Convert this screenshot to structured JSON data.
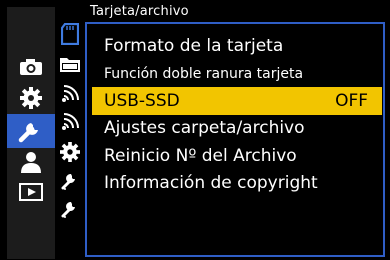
{
  "header": {
    "title": "Tarjeta/archivo"
  },
  "left_icons": [
    {
      "name": "camera-icon"
    },
    {
      "name": "gear-icon"
    },
    {
      "name": "wrench-icon",
      "selected": true
    },
    {
      "name": "person-icon"
    },
    {
      "name": "playback-icon"
    }
  ],
  "middle_icons": [
    {
      "name": "card-icon",
      "selected": true
    },
    {
      "name": "folder-icon"
    },
    {
      "name": "signal-icon-1"
    },
    {
      "name": "signal-icon-2"
    },
    {
      "name": "gear-icon"
    },
    {
      "name": "wrench-small-icon-1"
    },
    {
      "name": "wrench-small-icon-2"
    }
  ],
  "menu": {
    "items": [
      {
        "label": "Formato de la tarjeta",
        "value": ""
      },
      {
        "label": "Función doble ranura tarjeta",
        "value": ""
      },
      {
        "label": "USB-SSD",
        "value": "OFF",
        "selected": true
      },
      {
        "label": "Ajustes carpeta/archivo",
        "value": ""
      },
      {
        "label": "Reinicio Nº del Archivo",
        "value": ""
      },
      {
        "label": "Información de copyright",
        "value": ""
      }
    ]
  },
  "colors": {
    "accent": "#2f5ec6",
    "highlight": "#f2c500",
    "background": "#000000"
  }
}
